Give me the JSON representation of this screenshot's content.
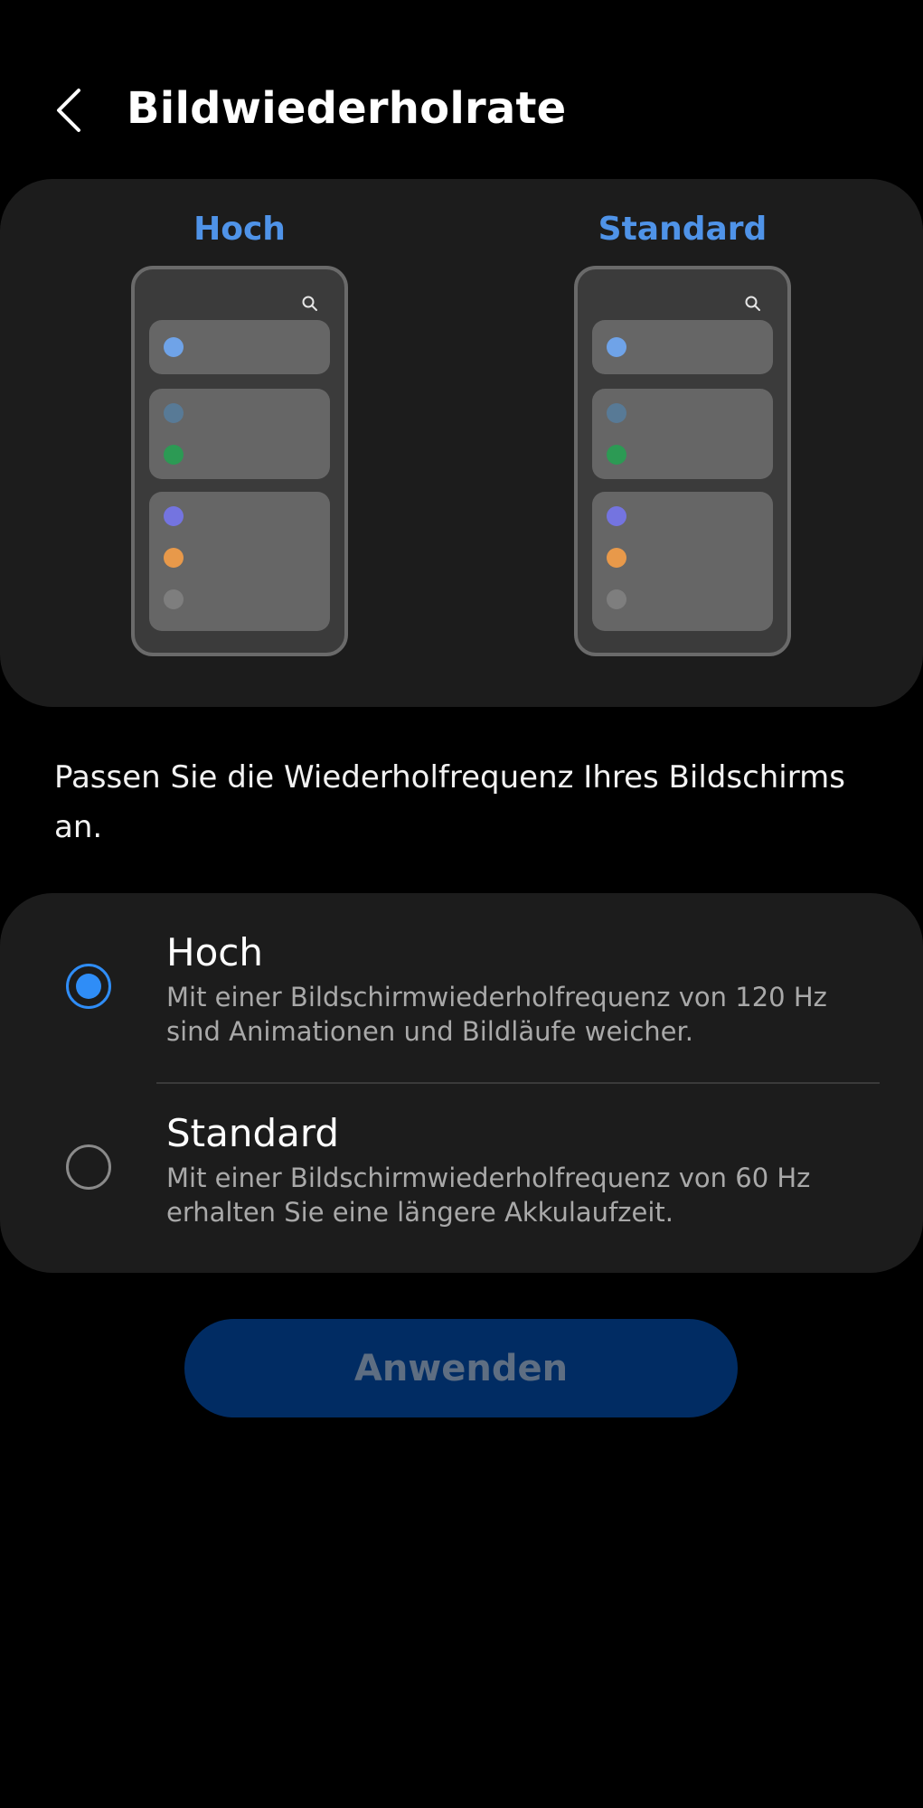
{
  "header": {
    "title": "Bildwiederholrate",
    "back_icon": "chevron-left-icon"
  },
  "preview": {
    "high_label": "Hoch",
    "standard_label": "Standard",
    "search_icon": "search-icon",
    "dot_colors": {
      "blue": "#6fa3e8",
      "slate": "#587a96",
      "green": "#2c9a54",
      "purple": "#7474e0",
      "orange": "#e8994a",
      "gray": "#7e7e7e"
    }
  },
  "description": "Passen Sie die Wiederholfrequenz Ihres Bildschirms an.",
  "options": [
    {
      "title": "Hoch",
      "description": "Mit einer Bildschirmwiederholfrequenz von 120 Hz sind Animationen und Bildläufe weicher.",
      "selected": true
    },
    {
      "title": "Standard",
      "description": "Mit einer Bildschirmwiederholfrequenz von 60 Hz erhalten Sie eine längere Akkulaufzeit.",
      "selected": false
    }
  ],
  "apply_button": {
    "label": "Anwenden",
    "enabled": false
  },
  "colors": {
    "background": "#000000",
    "card": "#1c1c1c",
    "accent": "#2f8df7",
    "preview_label": "#4f93e8",
    "button_bg": "#012c63",
    "button_text_disabled": "#5e6e82"
  }
}
